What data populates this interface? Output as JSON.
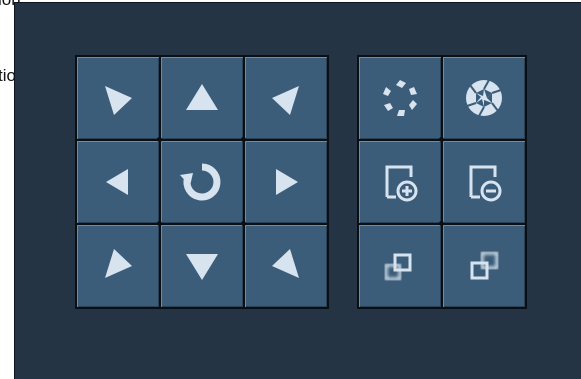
{
  "background_text": {
    "top": "ion",
    "left": "tio"
  },
  "ptz_controls": {
    "buttons": [
      {
        "name": "pan-up-left-button",
        "icon": "arrow-up-left-icon"
      },
      {
        "name": "tilt-up-button",
        "icon": "arrow-up-icon"
      },
      {
        "name": "pan-up-right-button",
        "icon": "arrow-up-right-icon"
      },
      {
        "name": "pan-left-button",
        "icon": "arrow-left-icon"
      },
      {
        "name": "auto-pan-button",
        "icon": "rotate-icon"
      },
      {
        "name": "pan-right-button",
        "icon": "arrow-right-icon"
      },
      {
        "name": "pan-down-left-button",
        "icon": "arrow-down-left-icon"
      },
      {
        "name": "tilt-down-button",
        "icon": "arrow-down-icon"
      },
      {
        "name": "pan-down-right-button",
        "icon": "arrow-down-right-icon"
      }
    ]
  },
  "lens_controls": {
    "buttons": [
      {
        "name": "iris-close-button",
        "icon": "iris-close-icon"
      },
      {
        "name": "iris-open-button",
        "icon": "iris-open-icon"
      },
      {
        "name": "zoom-in-button",
        "icon": "zoom-in-icon"
      },
      {
        "name": "zoom-out-button",
        "icon": "zoom-out-icon"
      },
      {
        "name": "focus-near-button",
        "icon": "focus-near-icon"
      },
      {
        "name": "focus-far-button",
        "icon": "focus-far-icon"
      }
    ]
  },
  "colors": {
    "panel_bg": "#243444",
    "button_bg": "#3c5d79",
    "icon": "#d7e4ef",
    "grid_line": "#0a0f14"
  }
}
